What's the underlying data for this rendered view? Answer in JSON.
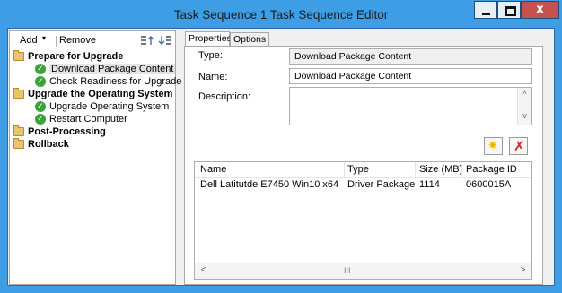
{
  "window": {
    "title": "Task Sequence 1 Task Sequence Editor",
    "close_glyph": "x",
    "colors": {
      "frame": "#3d9ee6",
      "close": "#c75050"
    }
  },
  "toolbar": {
    "add_label": "Add",
    "add_caret": "▾",
    "remove_label": "Remove",
    "icons": [
      "move-up-icon",
      "move-down-icon"
    ]
  },
  "tree": {
    "groups": [
      {
        "label": "Prepare for Upgrade",
        "icon": "folder-icon",
        "steps": [
          {
            "label": "Download Package Content",
            "icon": "check-icon",
            "selected": true
          },
          {
            "label": "Check Readiness for Upgrade",
            "icon": "check-icon",
            "selected": false
          }
        ]
      },
      {
        "label": "Upgrade the Operating System",
        "icon": "folder-icon",
        "steps": [
          {
            "label": "Upgrade Operating System",
            "icon": "check-icon",
            "selected": false
          },
          {
            "label": "Restart Computer",
            "icon": "check-icon",
            "selected": false
          }
        ]
      },
      {
        "label": "Post-Processing",
        "icon": "folder-icon",
        "steps": []
      },
      {
        "label": "Rollback",
        "icon": "folder-icon",
        "steps": []
      }
    ]
  },
  "tabs": [
    {
      "label": "Properties",
      "active": true
    },
    {
      "label": "Options",
      "active": false
    }
  ],
  "properties": {
    "type_label": "Type:",
    "type_value": "Download Package Content",
    "name_label": "Name:",
    "name_value": "Download Package Content",
    "description_label": "Description:",
    "description_value": "",
    "scroll_up": "^",
    "scroll_down": "v"
  },
  "actions": {
    "add_icon": "new-star-icon",
    "add_glyph": "✷",
    "delete_icon": "delete-x-icon",
    "delete_glyph": "✗"
  },
  "packages": {
    "columns": [
      "Name",
      "Type",
      "Size (MB)",
      "Package ID"
    ],
    "rows": [
      [
        "Dell Latitutde E7450 Win10 x64",
        "Driver Package",
        "1114",
        "0600015A"
      ]
    ],
    "scroll_left": "<",
    "scroll_right": ">",
    "scroll_thumb": "III"
  }
}
